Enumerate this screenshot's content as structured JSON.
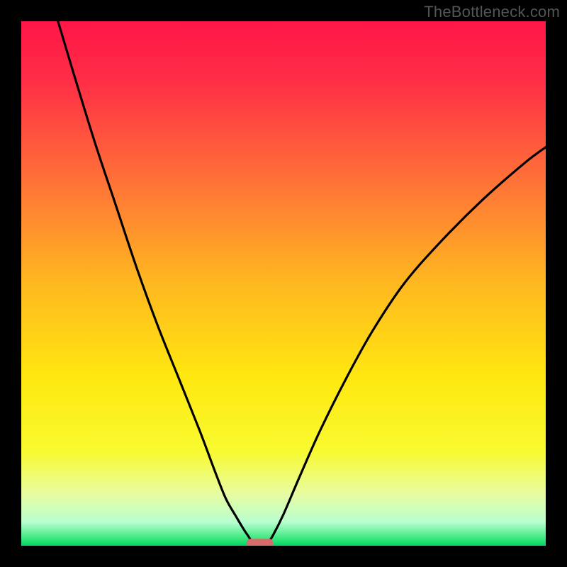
{
  "watermark": "TheBottleneck.com",
  "colors": {
    "frame": "#000000",
    "curve": "#000000",
    "marker": "#d86b6b"
  },
  "gradient_stops": [
    {
      "offset": 0.0,
      "color": "#ff1648"
    },
    {
      "offset": 0.12,
      "color": "#ff3046"
    },
    {
      "offset": 0.3,
      "color": "#ff7038"
    },
    {
      "offset": 0.5,
      "color": "#ffb820"
    },
    {
      "offset": 0.68,
      "color": "#ffe810"
    },
    {
      "offset": 0.82,
      "color": "#f8fa30"
    },
    {
      "offset": 0.9,
      "color": "#e8fca0"
    },
    {
      "offset": 0.955,
      "color": "#b8ffd0"
    },
    {
      "offset": 0.985,
      "color": "#40e880"
    },
    {
      "offset": 1.0,
      "color": "#00d860"
    }
  ],
  "chart_data": {
    "type": "line",
    "title": "",
    "xlabel": "",
    "ylabel": "",
    "xlim": [
      0,
      100
    ],
    "ylim": [
      0,
      100
    ],
    "series": [
      {
        "name": "left-curve",
        "x": [
          7,
          10,
          14,
          18,
          22,
          26,
          30,
          34,
          37,
          39,
          41,
          42.5,
          43.5,
          44
        ],
        "y": [
          100,
          90,
          77,
          65,
          53,
          42,
          32,
          22,
          14,
          9,
          5.5,
          3,
          1.5,
          0.5
        ]
      },
      {
        "name": "right-curve",
        "x": [
          47,
          48,
          50,
          53,
          57,
          62,
          67,
          73,
          80,
          88,
          96,
          100
        ],
        "y": [
          0.5,
          2,
          6,
          13,
          22,
          32,
          41,
          50,
          58,
          66,
          73,
          76
        ]
      }
    ],
    "marker": {
      "name": "min-marker",
      "x_range": [
        43,
        48
      ],
      "y": 0.5,
      "color": "#d86b6b"
    }
  }
}
